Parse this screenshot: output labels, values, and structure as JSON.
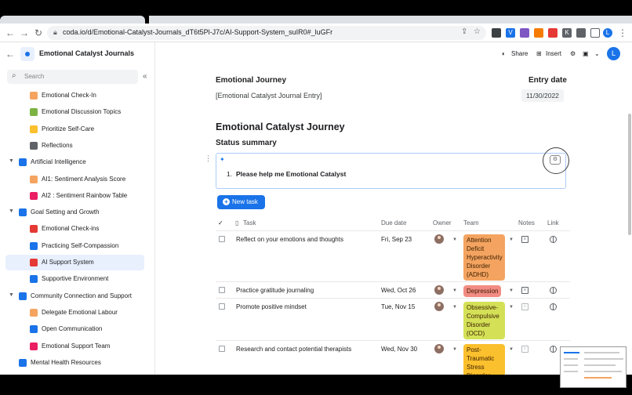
{
  "browser": {
    "url": "coda.io/d/Emotional-Catalyst-Journals_dT6t5Pl-J7c/AI-Support-System_suIR0#_luGFr",
    "profile_initial": "L"
  },
  "doc": {
    "title": "Emotional Catalyst Journals"
  },
  "search": {
    "placeholder": "Search"
  },
  "sidebar": {
    "items": [
      {
        "label": "Emotional Check-In",
        "level": 2
      },
      {
        "label": "Emotional Discussion Topics",
        "level": 2
      },
      {
        "label": "Prioritize Self-Care",
        "level": 2
      },
      {
        "label": "Reflections",
        "level": 2
      },
      {
        "label": "Artificial Intelligence",
        "level": 1
      },
      {
        "label": "AI1: Sentiment Analysis Score",
        "level": 2
      },
      {
        "label": "AI2 : Sentiment Rainbow Table",
        "level": 2
      },
      {
        "label": "Goal Setting and Growth",
        "level": 1
      },
      {
        "label": "Emotional Check-ins",
        "level": 2
      },
      {
        "label": "Practicing Self-Compassion",
        "level": 2
      },
      {
        "label": "AI Support System",
        "level": 2,
        "active": true
      },
      {
        "label": "Supportive Environment",
        "level": 2
      },
      {
        "label": "Community Connection and Support",
        "level": 1
      },
      {
        "label": "Delegate Emotional Labour",
        "level": 2
      },
      {
        "label": "Open Communication",
        "level": 2
      },
      {
        "label": "Emotional Support Team",
        "level": 2
      },
      {
        "label": "Mental Health Resources",
        "level": 1
      }
    ]
  },
  "topbar": {
    "share_label": "Share",
    "insert_label": "Insert",
    "avatar_initial": "L"
  },
  "page": {
    "journey_label": "Emotional Journey",
    "journey_value": "[Emotional Catalyst Journal Entry]",
    "entry_date_label": "Entry date",
    "entry_date_value": "11/30/2022",
    "heading": "Emotional Catalyst Journey",
    "status_summary": "Status summary",
    "ai_prompt_number": "1.",
    "ai_prompt_text": "Please help me Emotional Catalyst",
    "new_task_label": "New task"
  },
  "table": {
    "headers": {
      "check": "✓",
      "task": "Task",
      "due": "Due date",
      "owner": "Owner",
      "team": "Team",
      "notes": "Notes",
      "link": "Link"
    },
    "rows": [
      {
        "task": "Reflect on your emotions and thoughts",
        "due": "Fri, Sep 23",
        "team": "Attention Deficit Hyperactivity Disorder (ADHD)",
        "team_color": "#f4a460",
        "notes_active": true
      },
      {
        "task": "Practice gratitude journaling",
        "due": "Wed, Oct 26",
        "team": "Depression",
        "team_color": "#f28b82",
        "notes_active": true
      },
      {
        "task": "Promote positive mindset",
        "due": "Tue, Nov 15",
        "team": "Obsessive-Compulsive Disorder (OCD)",
        "team_color": "#d4e157",
        "notes_active": false
      },
      {
        "task": "Research and contact potential therapists",
        "due": "Wed, Nov 30",
        "team": "Post-Traumatic Stress Disorder",
        "team_color": "#fbc02d",
        "notes_active": false
      }
    ]
  },
  "colors": {
    "accent": "#1a73e8",
    "active_nav": "#e8f0fe"
  }
}
